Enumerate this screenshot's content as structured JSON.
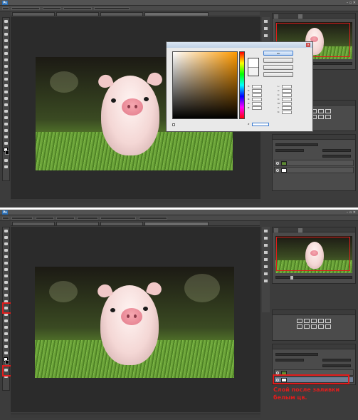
{
  "screens": [
    {
      "menus": [
        "",
        "",
        "",
        "",
        "",
        "",
        "",
        "",
        "",
        "",
        "",
        ""
      ],
      "tabs": [
        "",
        "",
        "",
        ""
      ],
      "status_zoom": "",
      "status_doc": "",
      "panel_tabs": [
        "",
        ""
      ],
      "layers": [
        {
          "name": "",
          "selected": false
        },
        {
          "name": "",
          "selected": false
        }
      ]
    },
    {
      "menus": [
        "",
        "",
        "",
        "",
        "",
        "",
        "",
        "",
        "",
        "",
        "",
        ""
      ],
      "tabs": [
        "",
        "",
        "",
        ""
      ],
      "status_zoom": "",
      "status_doc": "",
      "panel_tabs": [
        "",
        ""
      ],
      "layers": [
        {
          "name": "",
          "selected": false
        },
        {
          "name": "",
          "selected": true
        }
      ]
    }
  ],
  "color_dialog": {
    "title": "",
    "new_label": "",
    "current_label": "",
    "buttons": {
      "ok": "OK",
      "cancel": "",
      "add_swatch": "",
      "libraries": ""
    },
    "values": {
      "H": "",
      "S": "",
      "B": "",
      "R": "",
      "G": "",
      "Bl": "",
      "L": "",
      "a": "",
      "b": "",
      "C": "",
      "M": "",
      "Y": "",
      "K": ""
    },
    "hex": "",
    "web_only_label": ""
  },
  "annotation": {
    "text": "Слой после заливки белым цв.",
    "color": "#e21c1c"
  },
  "colors": {
    "accent_red": "#e01b1b",
    "ps_dark": "#3c3c3c",
    "ps_blue": "#2b6fb5"
  }
}
